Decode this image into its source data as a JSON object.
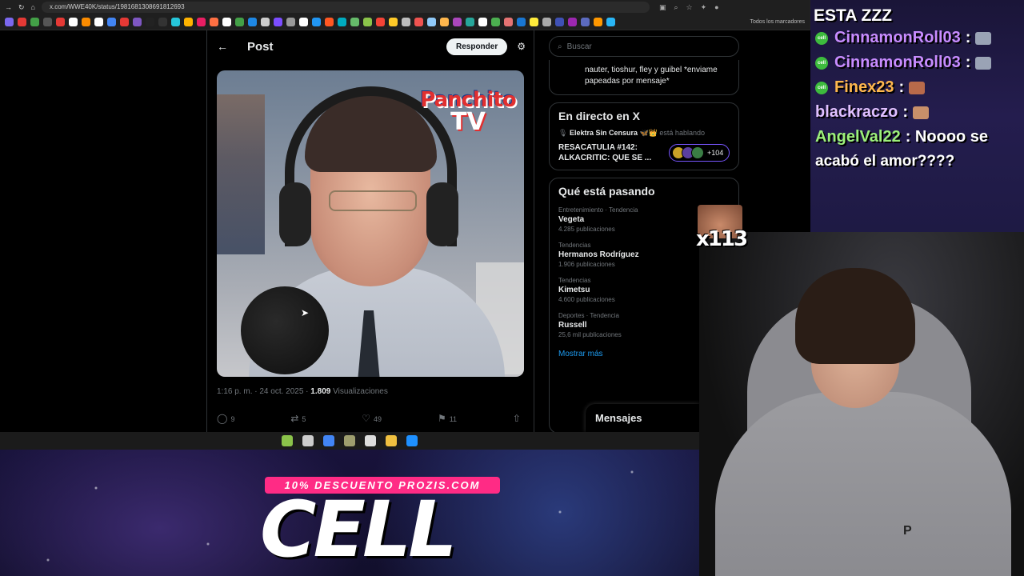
{
  "browser": {
    "url": "x.com/WWE40K/status/1981681308691812693",
    "bookmarks_label": "Todos los marcadores",
    "bookmark_colors": [
      "#7b68ee",
      "#e53935",
      "#43a047",
      "#555",
      "#e53935",
      "#fff",
      "#fb8c00",
      "#fff",
      "#4285f4",
      "#e53935",
      "#7e57c2",
      "#222",
      "#333",
      "#26c6da",
      "#ffb300",
      "#e91e63",
      "#ff7043",
      "#fff",
      "#43a047",
      "#1e88e5",
      "#ccc",
      "#7c4dff",
      "#999",
      "#fff",
      "#2196f3",
      "#ff5722",
      "#00acc1",
      "#66bb6a",
      "#8bc34a",
      "#f44336",
      "#ffca28",
      "#bdbdbd",
      "#ef5350",
      "#90caf9",
      "#ffb74d",
      "#ab47bc",
      "#26a69a",
      "#fff",
      "#4caf50",
      "#e57373",
      "#1976d2",
      "#ffeb3b",
      "#aaa",
      "#3f51b5",
      "#9c27b0",
      "#5c6bc0",
      "#ff9800",
      "#29b6f6"
    ]
  },
  "post": {
    "header_title": "Post",
    "reply_label": "Responder",
    "video_logo_top": "Panchito",
    "video_logo_bottom": "TV",
    "timestamp": "1:16 p. m. · 24 oct. 2025 · ",
    "views_count": "1.809",
    "views_label": "Visualizaciones",
    "replies": "9",
    "reposts": "5",
    "likes": "49",
    "bookmarks": "11"
  },
  "sidebar": {
    "search_placeholder": "Buscar",
    "reply_snippet": "nauter, tioshur, fley y guibel *enviame papeadas por mensaje*",
    "live_heading": "En directo en X",
    "live_host": "Elektra Sin Censura 🦋👑",
    "live_status": "está hablando",
    "live_title": "RESACATULIA #142: ALKACRITIC: QUE SE ...",
    "live_count": "+104",
    "trending_heading": "Qué está pasando",
    "trends": [
      {
        "category": "Entretenimiento · Tendencia",
        "name": "Vegeta",
        "posts": "4.285 publicaciones"
      },
      {
        "category": "Tendencias",
        "name": "Hermanos Rodríguez",
        "posts": "1.906 publicaciones"
      },
      {
        "category": "Tendencias",
        "name": "Kimetsu",
        "posts": "4.600 publicaciones"
      },
      {
        "category": "Deportes · Tendencia",
        "name": "Russell",
        "posts": "25,6 mil publicaciones"
      }
    ],
    "show_more": "Mostrar más",
    "messages_label": "Mensajes"
  },
  "taskbar": {
    "icon_colors": [
      "#8bc34a",
      "#ccc",
      "#4285f4",
      "#9e9e6e",
      "#ddd",
      "#f0c040",
      "#1e90ff"
    ]
  },
  "chat": {
    "header": "ESTA ZZZ",
    "badge_label": "cell",
    "messages": [
      {
        "user": "CinnamonRoll03",
        "color": "#c88cff",
        "text": ":",
        "emote_color": "#9aa3b5",
        "badge": true
      },
      {
        "user": "CinnamonRoll03",
        "color": "#c88cff",
        "text": ":",
        "emote_color": "#9aa3b5",
        "badge": true
      },
      {
        "user": "Finex23",
        "color": "#ffb84d",
        "text": ":",
        "emote_color": "#b86a4a",
        "badge": true
      },
      {
        "user": "blackraczo",
        "color": "#e0c0ff",
        "text": ":",
        "emote_color": "#c9906a",
        "badge": false
      },
      {
        "user": "AngelVal22",
        "color": "#9cf07a",
        "text": ": Noooo se",
        "emote_color": "",
        "badge": false
      }
    ],
    "continuation": "acabó el amor????"
  },
  "overlay": {
    "emote_multiplier": "x113",
    "promo_banner": "10% DESCUENTO PROZIS.COM",
    "promo_code": "CELL",
    "hoodie_logo": "P"
  }
}
